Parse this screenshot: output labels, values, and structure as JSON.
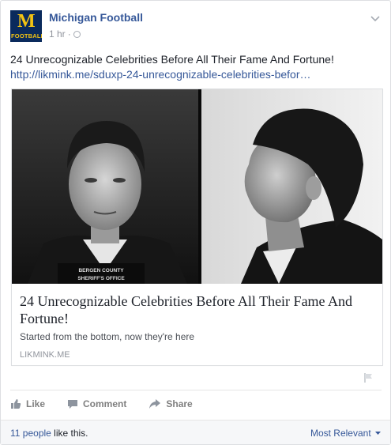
{
  "post": {
    "page_name": "Michigan Football",
    "time": "1 hr",
    "separator": "·",
    "logo": {
      "letter": "M",
      "text": "FOOTBALL"
    },
    "text": "24 Unrecognizable Celebrities Before All Their Fame And Fortune!",
    "link": "http://likmink.me/sduxp-24-unrecognizable-celebrities-befor…"
  },
  "card": {
    "photo_caption": "BERGEN COUNTY SHERIFF'S OFFICE",
    "title": "24 Unrecognizable Celebrities Before All Their Fame And Fortune!",
    "description": "Started from the bottom, now they're here",
    "domain": "LIKMINK.ME"
  },
  "actions": {
    "like": "Like",
    "comment": "Comment",
    "share": "Share"
  },
  "likes": {
    "people": "11 people",
    "suffix": " like this.",
    "sort": "Most Relevant"
  },
  "colors": {
    "link": "#365899",
    "logo_bg": "#0a2a5c",
    "logo_fg": "#f2c313",
    "action": "#7f7f7f"
  },
  "icons": [
    "globe-icon",
    "chevron-down-icon",
    "flag-icon",
    "like-icon",
    "comment-icon",
    "share-icon",
    "caret-down-icon"
  ]
}
